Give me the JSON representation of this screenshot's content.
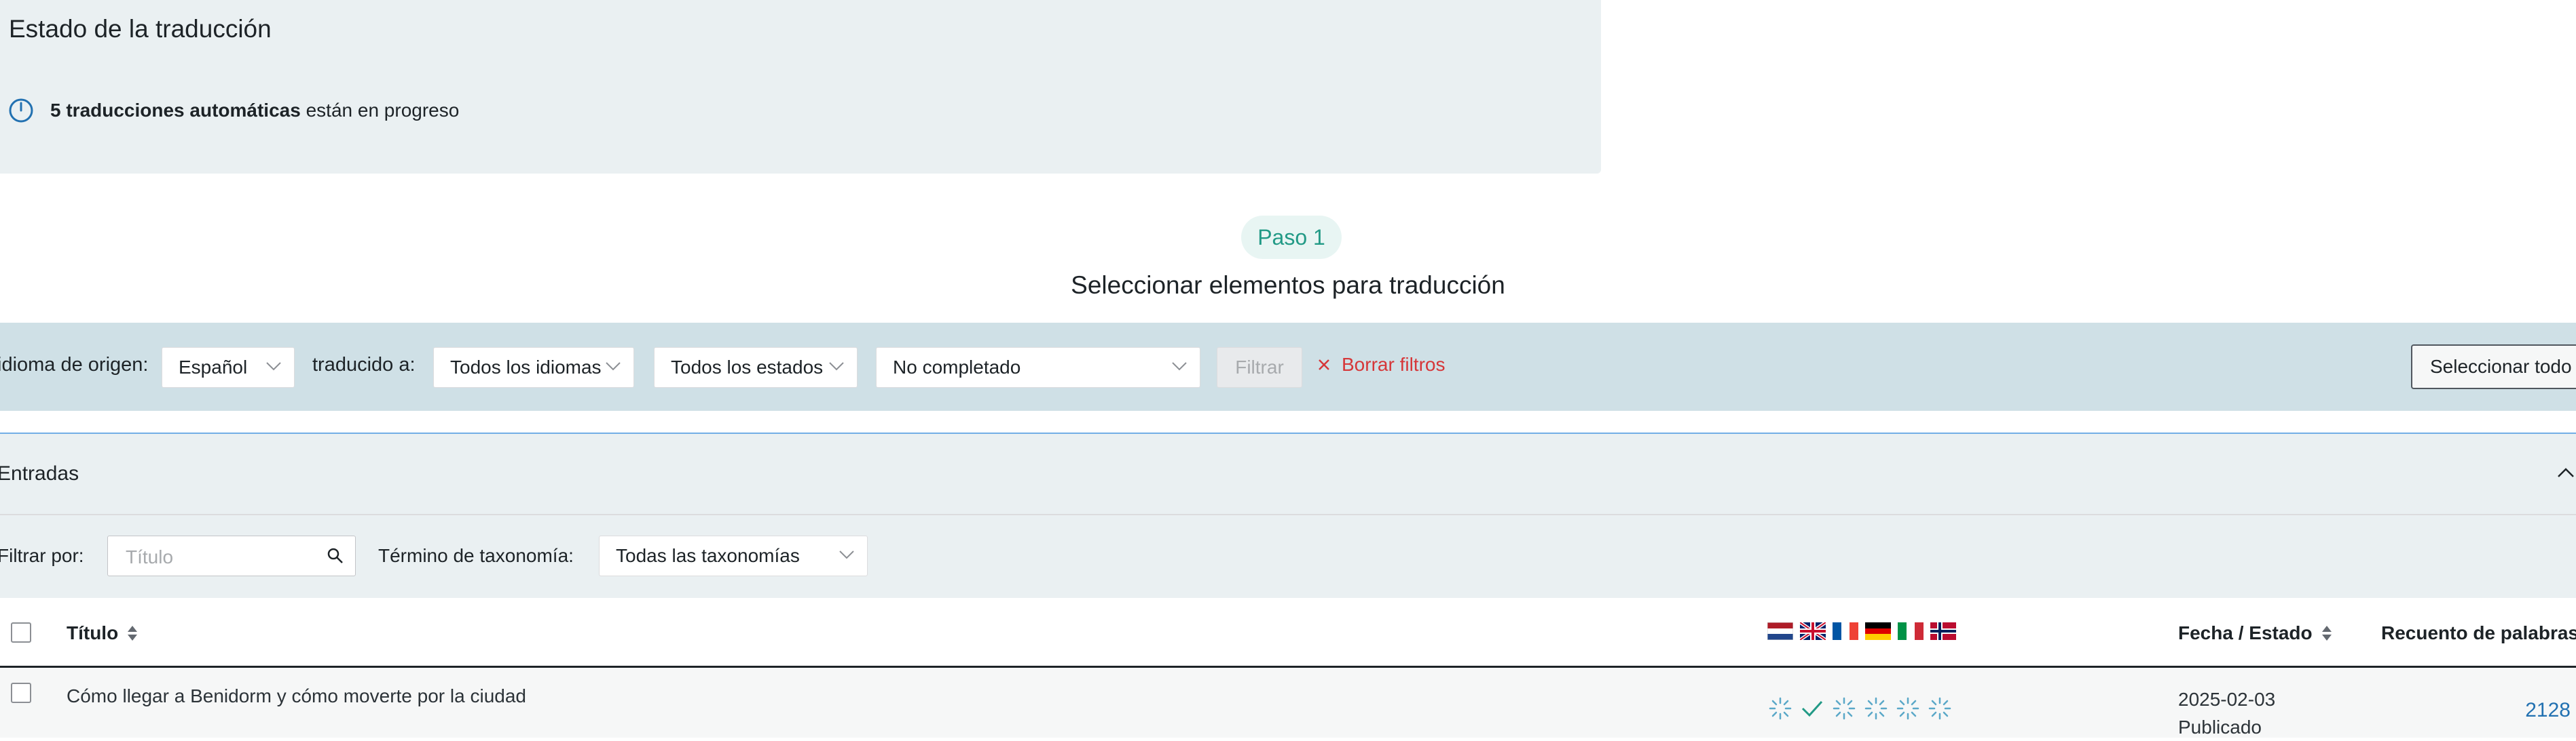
{
  "status": {
    "title": "Estado de la traducción",
    "count_text": "5 traducciones automáticas",
    "suffix_text": " están en progreso"
  },
  "step": {
    "label": "Paso 1",
    "title": "Seleccionar elementos para traducción"
  },
  "filters": {
    "source_label": "idioma de origen:",
    "source_value": "Español",
    "target_label": "traducido a:",
    "target_value": "Todos los idiomas",
    "status_value": "Todos los estados",
    "completion_value": "No completado",
    "filter_button": "Filtrar",
    "clear_label": "Borrar filtros",
    "select_all_button": "Seleccionar todo"
  },
  "entries": {
    "title": "Entradas",
    "filter_by_label": "Filtrar por:",
    "search_placeholder": "Título",
    "taxonomy_label": "Término de taxonomía:",
    "taxonomy_value": "Todas las taxonomías"
  },
  "table": {
    "col_title": "Título",
    "col_date": "Fecha / Estado",
    "col_words": "Recuento de palabras",
    "languages": [
      "nl",
      "en",
      "fr",
      "de",
      "it",
      "no"
    ],
    "rows": [
      {
        "title": "Cómo llegar a Benidorm y cómo moverte por la ciudad",
        "date": "2025-02-03",
        "status": "Publicado",
        "words": "2128",
        "language_status": [
          "in-progress",
          "complete",
          "in-progress",
          "in-progress",
          "in-progress",
          "in-progress"
        ]
      }
    ]
  },
  "colors": {
    "accent_teal": "#229a86",
    "link_blue": "#2271b1",
    "danger_red": "#d63638",
    "filter_bar_bg": "#cfe0e6",
    "panel_bg": "#eaf0f2"
  }
}
